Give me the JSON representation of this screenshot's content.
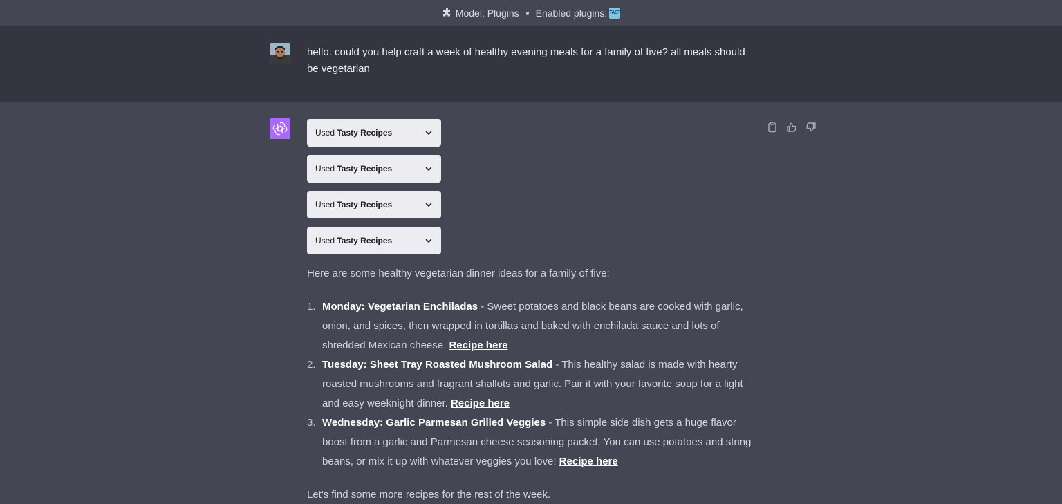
{
  "topbar": {
    "model_label": "Model: Plugins",
    "enabled_label": "Enabled plugins:",
    "plugin_logo_text": "TASTY"
  },
  "user_message": {
    "text": "hello. could you help craft a week of healthy evening meals for a family of five? all meals should be vegetarian"
  },
  "assistant": {
    "plugin_uses": [
      {
        "prefix": "Used",
        "name": "Tasty Recipes"
      },
      {
        "prefix": "Used",
        "name": "Tasty Recipes"
      },
      {
        "prefix": "Used",
        "name": "Tasty Recipes"
      },
      {
        "prefix": "Used",
        "name": "Tasty Recipes"
      }
    ],
    "intro": "Here are some healthy vegetarian dinner ideas for a family of five:",
    "meals": [
      {
        "number": "1.",
        "title": "Monday: Vegetarian Enchiladas",
        "description": " - Sweet potatoes and black beans are cooked with garlic, onion, and spices, then wrapped in tortillas and baked with enchilada sauce and lots of shredded Mexican cheese. ",
        "link": "Recipe here"
      },
      {
        "number": "2.",
        "title": "Tuesday: Sheet Tray Roasted Mushroom Salad",
        "description": " - This healthy salad is made with hearty roasted mushrooms and fragrant shallots and garlic. Pair it with your favorite soup for a light and easy weeknight dinner. ",
        "link": "Recipe here"
      },
      {
        "number": "3.",
        "title": "Wednesday: Garlic Parmesan Grilled Veggies",
        "description": " - This simple side dish gets a huge flavor boost from a garlic and Parmesan cheese seasoning packet. You can use potatoes and string beans, or mix it up with whatever veggies you love! ",
        "link": "Recipe here"
      }
    ],
    "outro": "Let's find some more recipes for the rest of the week."
  },
  "icons": {
    "model": "puzzle-icon",
    "copy": "clipboard-icon",
    "like": "thumbs-up-icon",
    "dislike": "thumbs-down-icon",
    "expand": "chevron-down-icon"
  },
  "colors": {
    "background": "#444654",
    "user_bg": "#343541",
    "assistant_avatar": "#ab68ff",
    "pill_bg": "#ececf1"
  }
}
